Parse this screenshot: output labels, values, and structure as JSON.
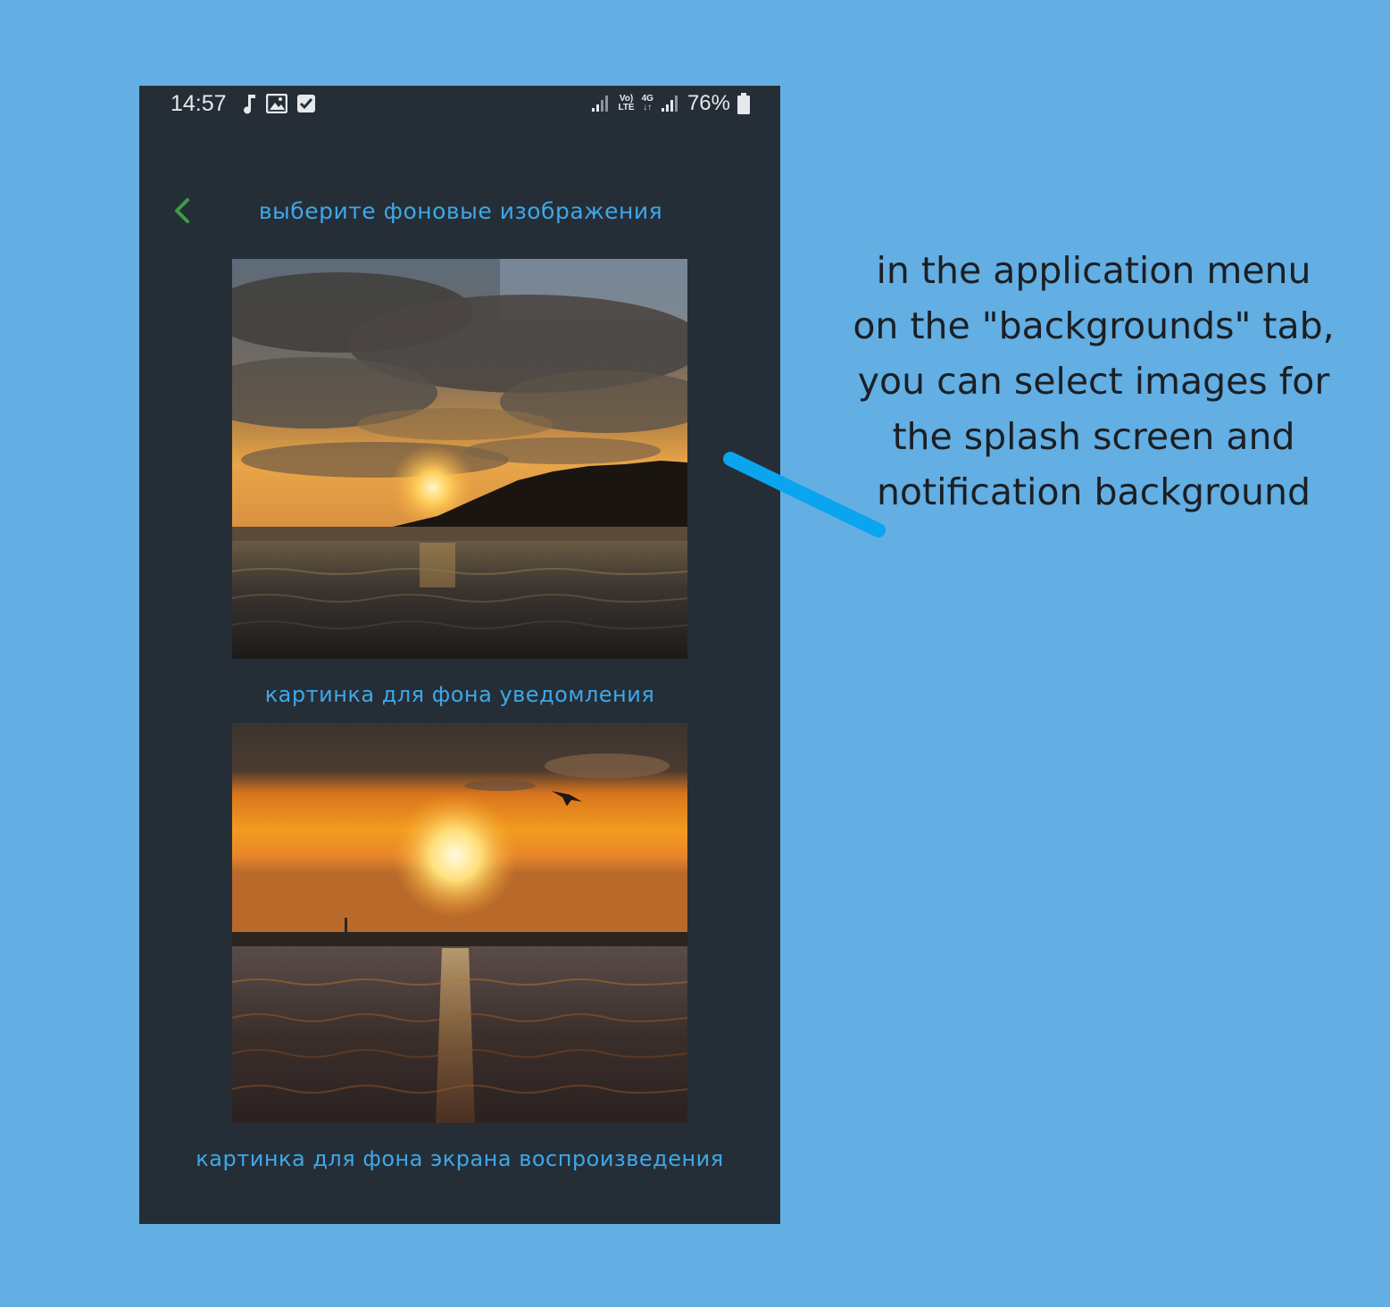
{
  "status_bar": {
    "time": "14:57",
    "left_icons": [
      "music-note-icon",
      "image-icon",
      "checkbox-icon"
    ],
    "network_volte": "Vo)\nLTE",
    "network_4g": "4G\n↓↑",
    "battery": "76%"
  },
  "toolbar": {
    "title": "выберите фоновые изображения",
    "back_icon": "chevron-left-icon",
    "back_color": "#3b9d46"
  },
  "images": [
    {
      "caption": "картинка для фона уведомления",
      "scene": "sunset-over-river-with-forested-shore"
    },
    {
      "caption": "картинка для фона экрана воспроизведения",
      "scene": "sunset-sun-reflection-on-water-with-bird"
    }
  ],
  "annotation": {
    "lines": [
      "in the application menu",
      "on the \"backgrounds\" tab,",
      "you can select images for",
      "the splash screen and",
      "notification background"
    ],
    "pointer_color": "#0aa5ef"
  },
  "colors": {
    "page_background": "#63aee2",
    "phone_background": "#252e37",
    "accent_text": "#3fa7e8"
  }
}
